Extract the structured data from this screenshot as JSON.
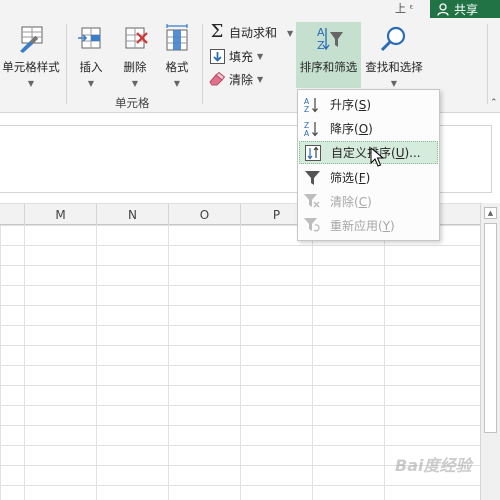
{
  "topbar": {
    "user_glyph": "上 ᵋ",
    "share_label": "共享",
    "share_color": "#217346"
  },
  "ribbon": {
    "cell_style": "单元格样式",
    "insert": "插入",
    "delete": "删除",
    "format": "格式",
    "cells_group": "单元格",
    "autosum": "自动求和",
    "fill": "填充",
    "clear": "清除",
    "sort_filter": "排序和筛选",
    "find_select": "查找和选择",
    "active_bg": "#c5e0cf"
  },
  "columns": [
    "M",
    "N",
    "O",
    "P"
  ],
  "menu": {
    "items": [
      {
        "label": "升序(",
        "key": "S",
        "suffix": ")",
        "icon": "sort-ascending-icon",
        "enabled": true
      },
      {
        "label": "降序(",
        "key": "O",
        "suffix": ")",
        "icon": "sort-descending-icon",
        "enabled": true
      },
      {
        "label": "自定义排序(",
        "key": "U",
        "suffix": ")...",
        "icon": "custom-sort-icon",
        "enabled": true,
        "highlighted": true
      },
      {
        "label": "筛选(",
        "key": "F",
        "suffix": ")",
        "icon": "filter-icon",
        "enabled": true
      },
      {
        "label": "清除(",
        "key": "C",
        "suffix": ")",
        "icon": "clear-filter-icon",
        "enabled": false
      },
      {
        "label": "重新应用(",
        "key": "Y",
        "suffix": ")",
        "icon": "reapply-filter-icon",
        "enabled": false
      }
    ],
    "highlight_color": "#d5ebdc"
  },
  "watermark": "Bai度经验"
}
